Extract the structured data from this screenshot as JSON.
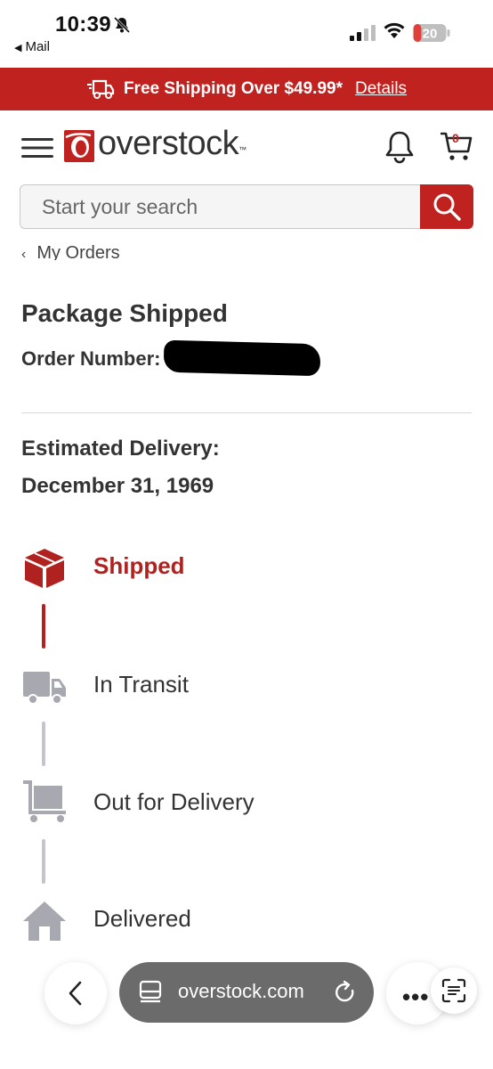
{
  "status_bar": {
    "time": "10:39",
    "back_app": "Mail",
    "battery": "20"
  },
  "promo": {
    "text": "Free Shipping Over $49.99*",
    "link": "Details"
  },
  "header": {
    "logo": "overstock",
    "cart_count": "0"
  },
  "search": {
    "placeholder": "Start your search"
  },
  "breadcrumb": "My Orders",
  "order": {
    "title": "Package Shipped",
    "number_label": "Order Number:",
    "estimated_label": "Estimated Delivery:",
    "estimated_date": "December 31, 1969"
  },
  "tracker": {
    "steps": [
      {
        "label": "Shipped",
        "icon": "box-icon",
        "status": "active"
      },
      {
        "label": "In Transit",
        "icon": "truck-icon",
        "status": "inactive"
      },
      {
        "label": "Out for Delivery",
        "icon": "cart-icon",
        "status": "inactive"
      },
      {
        "label": "Delivered",
        "icon": "house-icon",
        "status": "inactive"
      }
    ]
  },
  "browser": {
    "url": "overstock.com"
  },
  "colors": {
    "brand_red": "#c0221f",
    "inactive_gray": "#a8a8b0"
  }
}
